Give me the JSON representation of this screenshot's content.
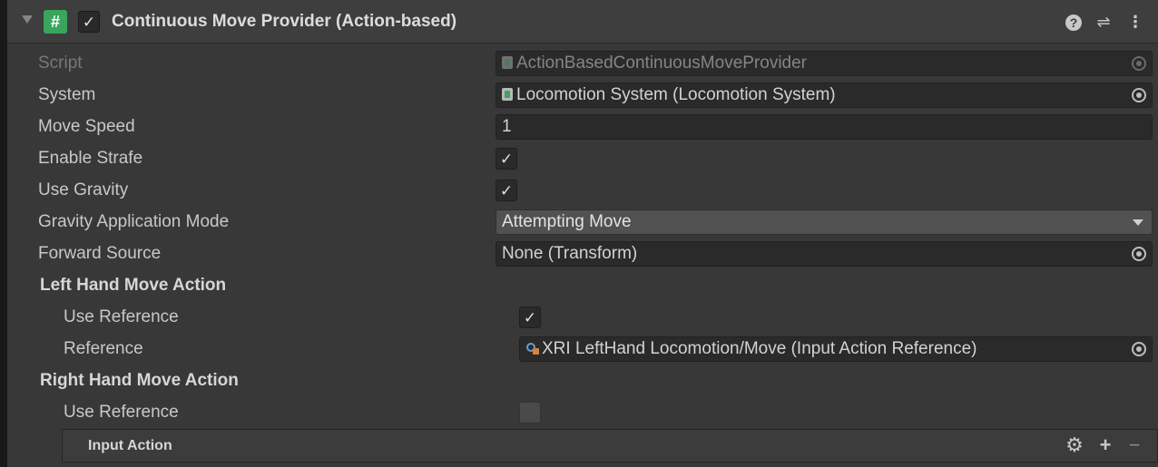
{
  "header": {
    "title": "Continuous Move Provider (Action-based)",
    "script_icon_glyph": "#",
    "enabled_check": "✓",
    "help_glyph": "?",
    "preset_glyph": "⇌",
    "menu_glyph": "⋮"
  },
  "fields": {
    "script": {
      "label": "Script",
      "value": "ActionBasedContinuousMoveProvider"
    },
    "system": {
      "label": "System",
      "value": "Locomotion System (Locomotion System)"
    },
    "move_speed": {
      "label": "Move Speed",
      "value": "1"
    },
    "enable_strafe": {
      "label": "Enable Strafe",
      "checked": true,
      "glyph": "✓"
    },
    "use_gravity": {
      "label": "Use Gravity",
      "checked": true,
      "glyph": "✓"
    },
    "gravity_mode": {
      "label": "Gravity Application Mode",
      "value": "Attempting Move"
    },
    "forward_source": {
      "label": "Forward Source",
      "value": "None (Transform)"
    }
  },
  "left_hand": {
    "title": "Left Hand Move Action",
    "use_reference": {
      "label": "Use Reference",
      "checked": true,
      "glyph": "✓"
    },
    "reference": {
      "label": "Reference",
      "value": "XRI LeftHand Locomotion/Move (Input Action Reference)"
    }
  },
  "right_hand": {
    "title": "Right Hand Move Action",
    "use_reference": {
      "label": "Use Reference",
      "checked": false,
      "glyph": ""
    },
    "input_action": {
      "title": "Input Action",
      "gear_glyph": "⚙",
      "plus_glyph": "+",
      "minus_glyph": "−"
    }
  },
  "colors": {
    "background": "#383838",
    "field": "#2a2a2a",
    "script_icon": "#3aa55c"
  }
}
